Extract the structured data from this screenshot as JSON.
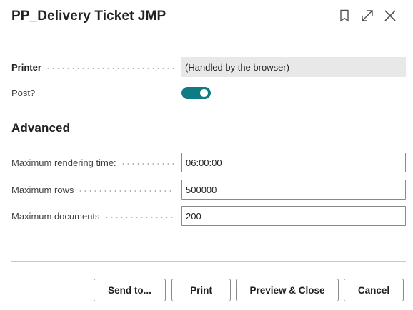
{
  "dialog": {
    "title": "PP_Delivery Ticket JMP",
    "icons": [
      "bookmark-icon",
      "expand-icon",
      "close-icon"
    ]
  },
  "fields": {
    "printer": {
      "label": "Printer",
      "value": "(Handled by the browser)"
    },
    "post": {
      "label": "Post?",
      "value": true
    }
  },
  "advanced": {
    "title": "Advanced",
    "max_rendering_time": {
      "label": "Maximum rendering time:",
      "value": "06:00:00"
    },
    "max_rows": {
      "label": "Maximum rows",
      "value": "500000"
    },
    "max_documents": {
      "label": "Maximum documents",
      "value": "200"
    }
  },
  "actions": {
    "send_to": "Send to...",
    "print": "Print",
    "preview_close": "Preview & Close",
    "cancel": "Cancel"
  },
  "colors": {
    "toggle_on": "#0f7b85",
    "readonly_bg": "#e8e8e8"
  }
}
